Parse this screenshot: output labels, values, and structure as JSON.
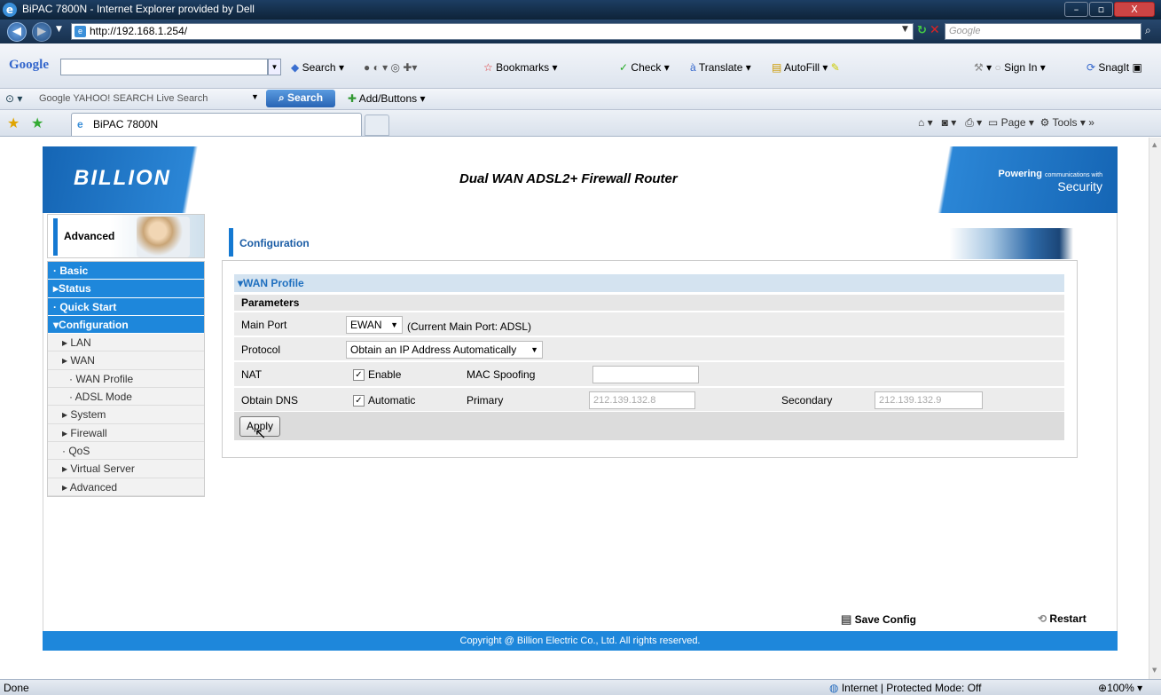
{
  "window": {
    "title": "BiPAC 7800N - Internet Explorer provided by Dell",
    "min": "–",
    "max": "▫",
    "close": "X"
  },
  "address": {
    "url": "http://192.168.1.254/",
    "search_placeholder": "Google"
  },
  "google_toolbar": {
    "logo": "Google",
    "items": [
      "Search",
      "Bookmarks",
      "Check",
      "Translate",
      "AutoFill",
      "Sign In",
      "SnagIt"
    ]
  },
  "yahoo_toolbar": {
    "engines": "Google YAHOO! SEARCH Live Search",
    "search_btn": "Search",
    "add_buttons": "Add/Buttons"
  },
  "tabs": {
    "active": "BiPAC 7800N"
  },
  "command_bar": {
    "page": "Page",
    "tools": "Tools"
  },
  "router": {
    "logo": "BILLION",
    "title": "Dual WAN ADSL2+ Firewall Router",
    "tagline_top": "Powering",
    "tagline_small": "communications with",
    "tagline_bottom": "Security",
    "section": "Advanced",
    "menu": [
      {
        "label": "· Basic",
        "kind": "main"
      },
      {
        "label": "▸Status",
        "kind": "main"
      },
      {
        "label": "· Quick Start",
        "kind": "main"
      },
      {
        "label": "▾Configuration",
        "kind": "main"
      },
      {
        "label": "▸ LAN",
        "kind": "sub"
      },
      {
        "label": "▸ WAN",
        "kind": "sub"
      },
      {
        "label": "· WAN Profile",
        "kind": "sub2"
      },
      {
        "label": "· ADSL Mode",
        "kind": "sub2"
      },
      {
        "label": "▸ System",
        "kind": "sub"
      },
      {
        "label": "▸ Firewall",
        "kind": "sub"
      },
      {
        "label": "· QoS",
        "kind": "sub"
      },
      {
        "label": "▸ Virtual Server",
        "kind": "sub"
      },
      {
        "label": "▸ Advanced",
        "kind": "sub"
      }
    ],
    "page_title": "Configuration",
    "wan_profile": "▾WAN Profile",
    "parameters": "Parameters",
    "main_port_label": "Main Port",
    "main_port_value": "EWAN",
    "main_port_note": "(Current Main Port: ADSL)",
    "protocol_label": "Protocol",
    "protocol_value": "Obtain an IP Address Automatically",
    "nat_label": "NAT",
    "nat_enable": "Enable",
    "mac_spoof_label": "MAC Spoofing",
    "mac_spoof_value": "",
    "dns_label": "Obtain DNS",
    "dns_auto": "Automatic",
    "primary_label": "Primary",
    "primary_value": "212.139.132.8",
    "secondary_label": "Secondary",
    "secondary_value": "212.139.132.9",
    "apply": "Apply",
    "save_config": "Save Config",
    "restart": "Restart",
    "copyright": "Copyright @ Billion Electric Co., Ltd. All rights reserved."
  },
  "status": {
    "left": "Done",
    "zone": "Internet | Protected Mode: Off",
    "zoom": "100%"
  }
}
